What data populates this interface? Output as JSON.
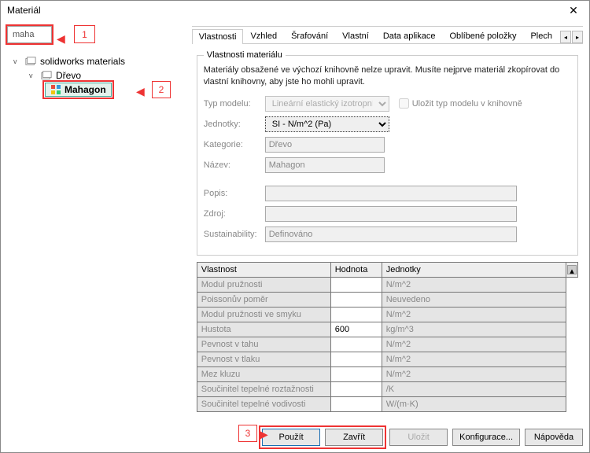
{
  "window": {
    "title": "Materiál",
    "close": "✕"
  },
  "annotations": {
    "n1": "1",
    "n2": "2",
    "n3": "3"
  },
  "search": {
    "value": "maha"
  },
  "tree": {
    "library": "solidworks materials",
    "category": "Dřevo",
    "selected": "Mahagon"
  },
  "tabs": {
    "items": [
      "Vlastnosti",
      "Vzhled",
      "Šrafování",
      "Vlastní",
      "Data aplikace",
      "Oblíbené položky",
      "Plech"
    ],
    "activeIndex": 0,
    "left": "◂",
    "right": "▸"
  },
  "props": {
    "legend": "Vlastnosti materiálu",
    "hint": "Materiály obsažené ve výchozí knihovně nelze upravit. Musíte nejprve materiál zkopírovat do vlastní knihovny, aby jste ho mohli upravit.",
    "fields": {
      "modelType": {
        "label": "Typ modelu:",
        "value": "Lineární elastický izotropní"
      },
      "units": {
        "label": "Jednotky:",
        "value": "SI - N/m^2 (Pa)"
      },
      "category": {
        "label": "Kategorie:",
        "value": "Dřevo"
      },
      "name": {
        "label": "Název:",
        "value": "Mahagon"
      },
      "desc": {
        "label": "Popis:",
        "value": ""
      },
      "source": {
        "label": "Zdroj:",
        "value": ""
      },
      "sustain": {
        "label": "Sustainability:",
        "value": "Definováno"
      },
      "saveType": "Uložit typ modelu v knihovně"
    },
    "table": {
      "headers": [
        "Vlastnost",
        "Hodnota",
        "Jednotky"
      ],
      "rows": [
        [
          "Modul pružnosti",
          "",
          "N/m^2"
        ],
        [
          "Poissonův poměr",
          "",
          "Neuvedeno"
        ],
        [
          "Modul pružnosti ve smyku",
          "",
          "N/m^2"
        ],
        [
          "Hustota",
          "600",
          "kg/m^3"
        ],
        [
          "Pevnost v tahu",
          "",
          "N/m^2"
        ],
        [
          "Pevnost v tlaku",
          "",
          "N/m^2"
        ],
        [
          "Mez kluzu",
          "",
          "N/m^2"
        ],
        [
          "Součinitel tepelné roztažnosti",
          "",
          "/K"
        ],
        [
          "Součinitel tepelné vodivosti",
          "",
          "W/(m·K)"
        ]
      ]
    }
  },
  "footer": {
    "apply": "Použít",
    "close": "Zavřít",
    "save": "Uložit",
    "config": "Konfigurace...",
    "help": "Nápověda"
  }
}
